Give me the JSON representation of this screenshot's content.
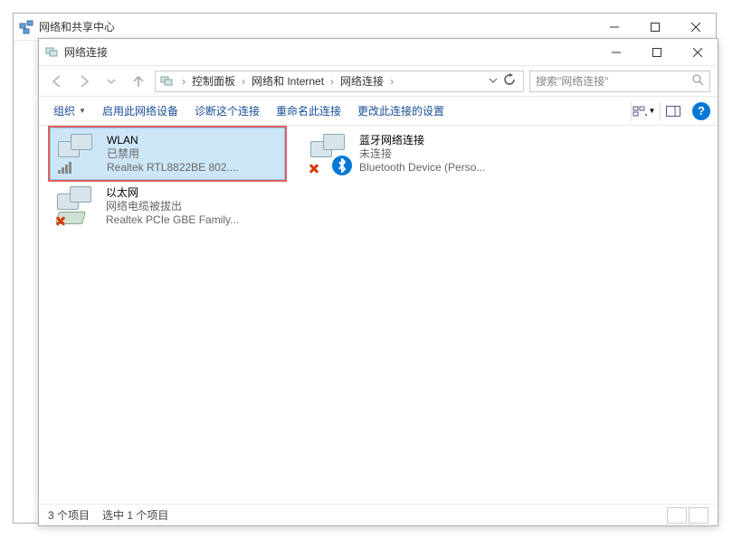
{
  "bg_window": {
    "title": "网络和共享中心"
  },
  "fg_window": {
    "title": "网络连接"
  },
  "breadcrumb": {
    "items": [
      "控制面板",
      "网络和 Internet",
      "网络连接"
    ]
  },
  "search": {
    "placeholder": "搜索\"网络连接\""
  },
  "commands": {
    "organize": "组织",
    "enable": "启用此网络设备",
    "diagnose": "诊断这个连接",
    "rename": "重命名此连接",
    "change": "更改此连接的设置"
  },
  "connections": [
    {
      "name": "WLAN",
      "status": "已禁用",
      "device": "Realtek RTL8822BE 802....",
      "icon": "wlan",
      "selected": true,
      "highlight": true,
      "error": false
    },
    {
      "name": "蓝牙网络连接",
      "status": "未连接",
      "device": "Bluetooth Device (Perso...",
      "icon": "bluetooth",
      "selected": false,
      "highlight": false,
      "error": true
    },
    {
      "name": "以太网",
      "status": "网络电缆被拔出",
      "device": "Realtek PCIe GBE Family...",
      "icon": "ethernet",
      "selected": false,
      "highlight": false,
      "error": true
    }
  ],
  "statusbar": {
    "count": "3 个项目",
    "selected": "选中 1 个项目"
  },
  "help_label": "?"
}
